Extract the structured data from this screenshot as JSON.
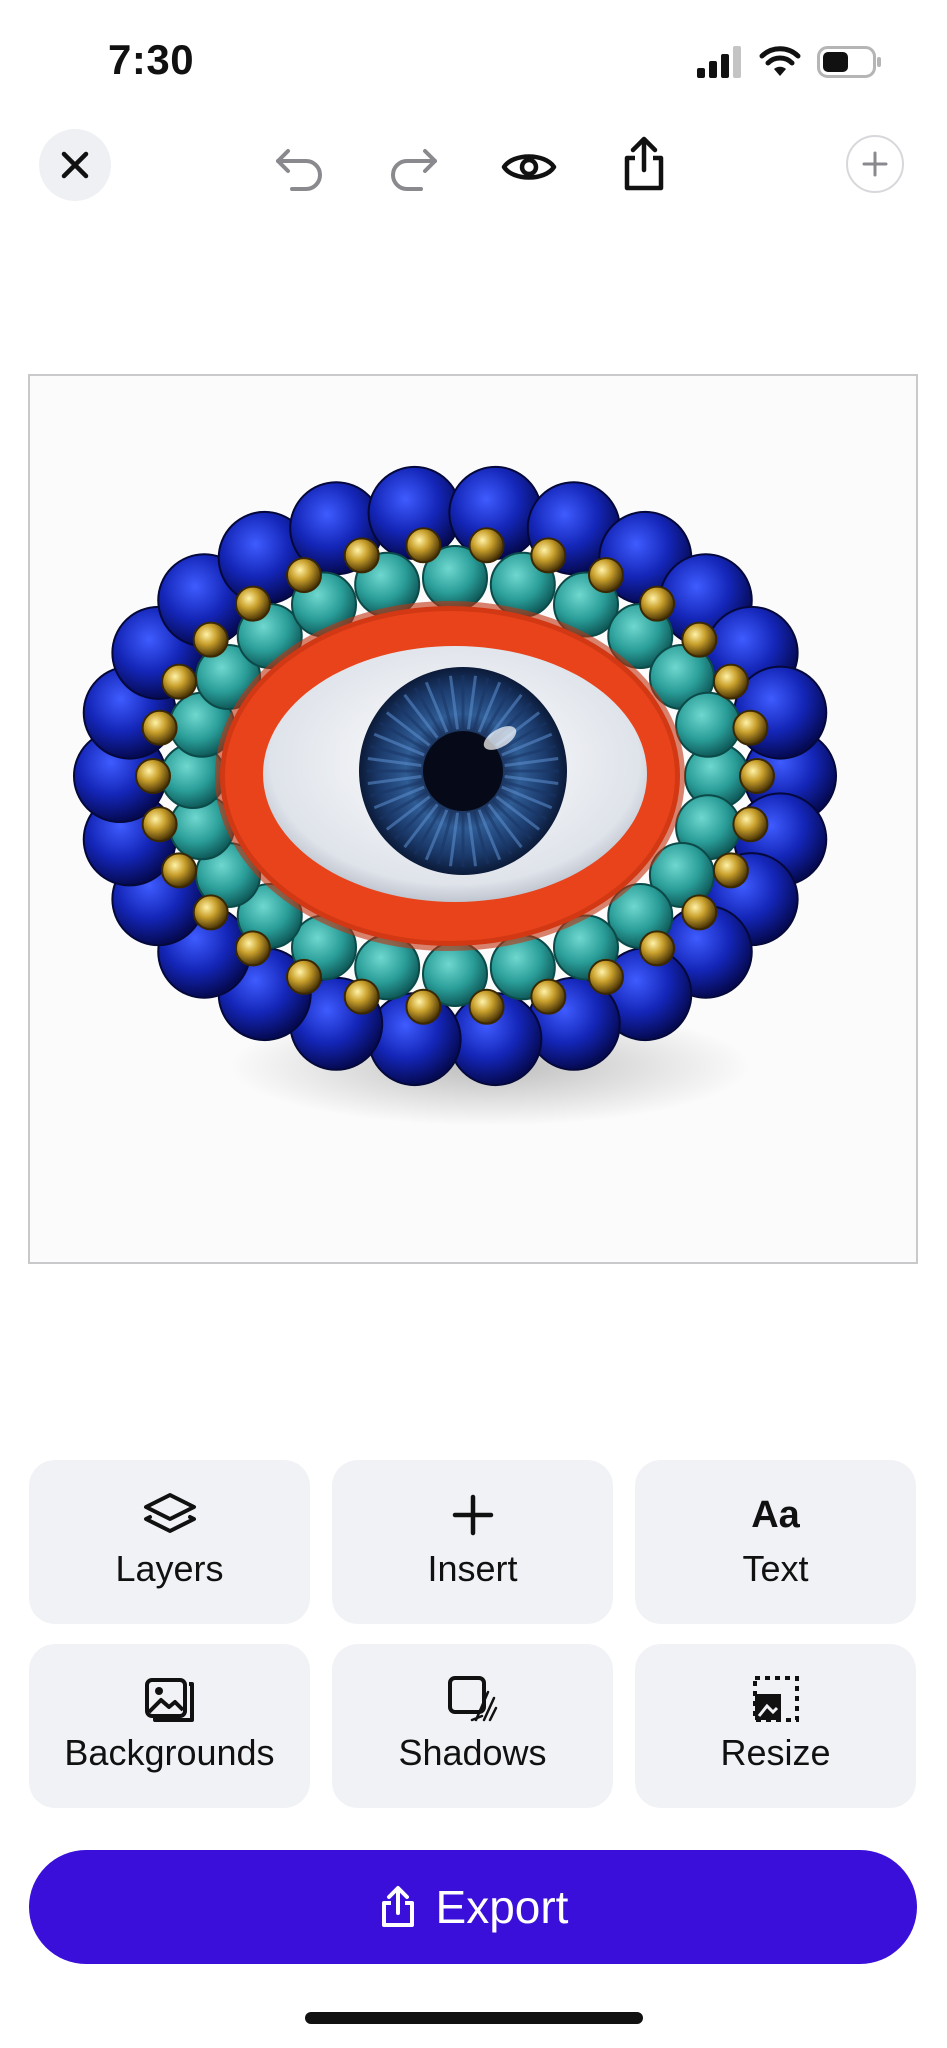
{
  "status_bar": {
    "time": "7:30",
    "icons": [
      "cellular-signal-icon",
      "wifi-icon",
      "battery-icon"
    ]
  },
  "toolbar": {
    "buttons": [
      "close-icon",
      "undo-icon",
      "redo-icon",
      "preview-eye-icon",
      "share-icon",
      "add-icon"
    ]
  },
  "canvas": {
    "image_subject": "beaded-evil-eye-brooch"
  },
  "tools": [
    {
      "label": "Layers",
      "icon": "layers-icon"
    },
    {
      "label": "Insert",
      "icon": "plus-icon"
    },
    {
      "label": "Text",
      "icon": "text-aa-icon",
      "glyph": "Aa"
    },
    {
      "label": "Backgrounds",
      "icon": "image-stack-icon"
    },
    {
      "label": "Shadows",
      "icon": "shadow-square-icon"
    },
    {
      "label": "Resize",
      "icon": "resize-icon"
    }
  ],
  "export": {
    "label": "Export",
    "icon": "share-icon"
  },
  "colors": {
    "accent": "#3a0fd9",
    "tile_background": "#f1f2f6",
    "close_background": "#eef0f4"
  }
}
